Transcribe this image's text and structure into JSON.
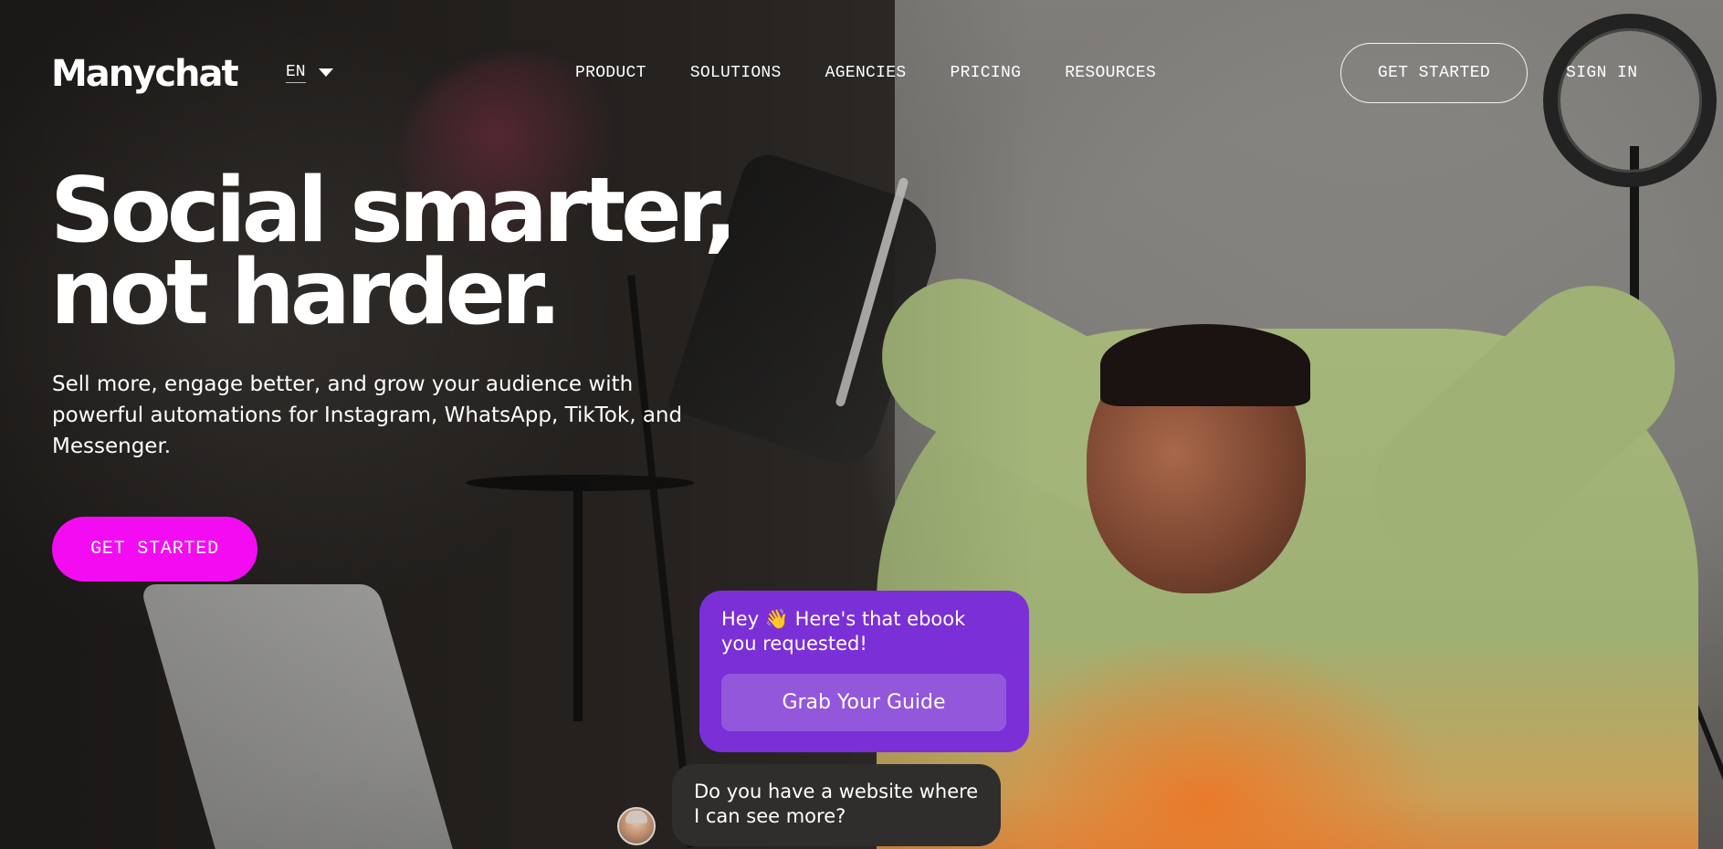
{
  "brand": {
    "logo": "Manychat",
    "accent": "#f30cf2",
    "chat_purple": "#7b2fd6"
  },
  "language": {
    "current": "EN"
  },
  "nav": {
    "items": [
      "PRODUCT",
      "SOLUTIONS",
      "AGENCIES",
      "PRICING",
      "RESOURCES"
    ]
  },
  "header_actions": {
    "get_started": "GET STARTED",
    "sign_in": "SIGN IN"
  },
  "hero": {
    "title_line1": "Social smarter,",
    "title_line2": "not harder.",
    "subtitle": "Sell more, engage better, and grow your audience with powerful automations for Instagram, WhatsApp, TikTok, and Messenger.",
    "cta": "GET STARTED"
  },
  "chat": {
    "bot_message": "Hey 👋 Here's that ebook you requested!",
    "bot_button": "Grab Your Guide",
    "user_message": "Do you have a website where I can see more?"
  }
}
